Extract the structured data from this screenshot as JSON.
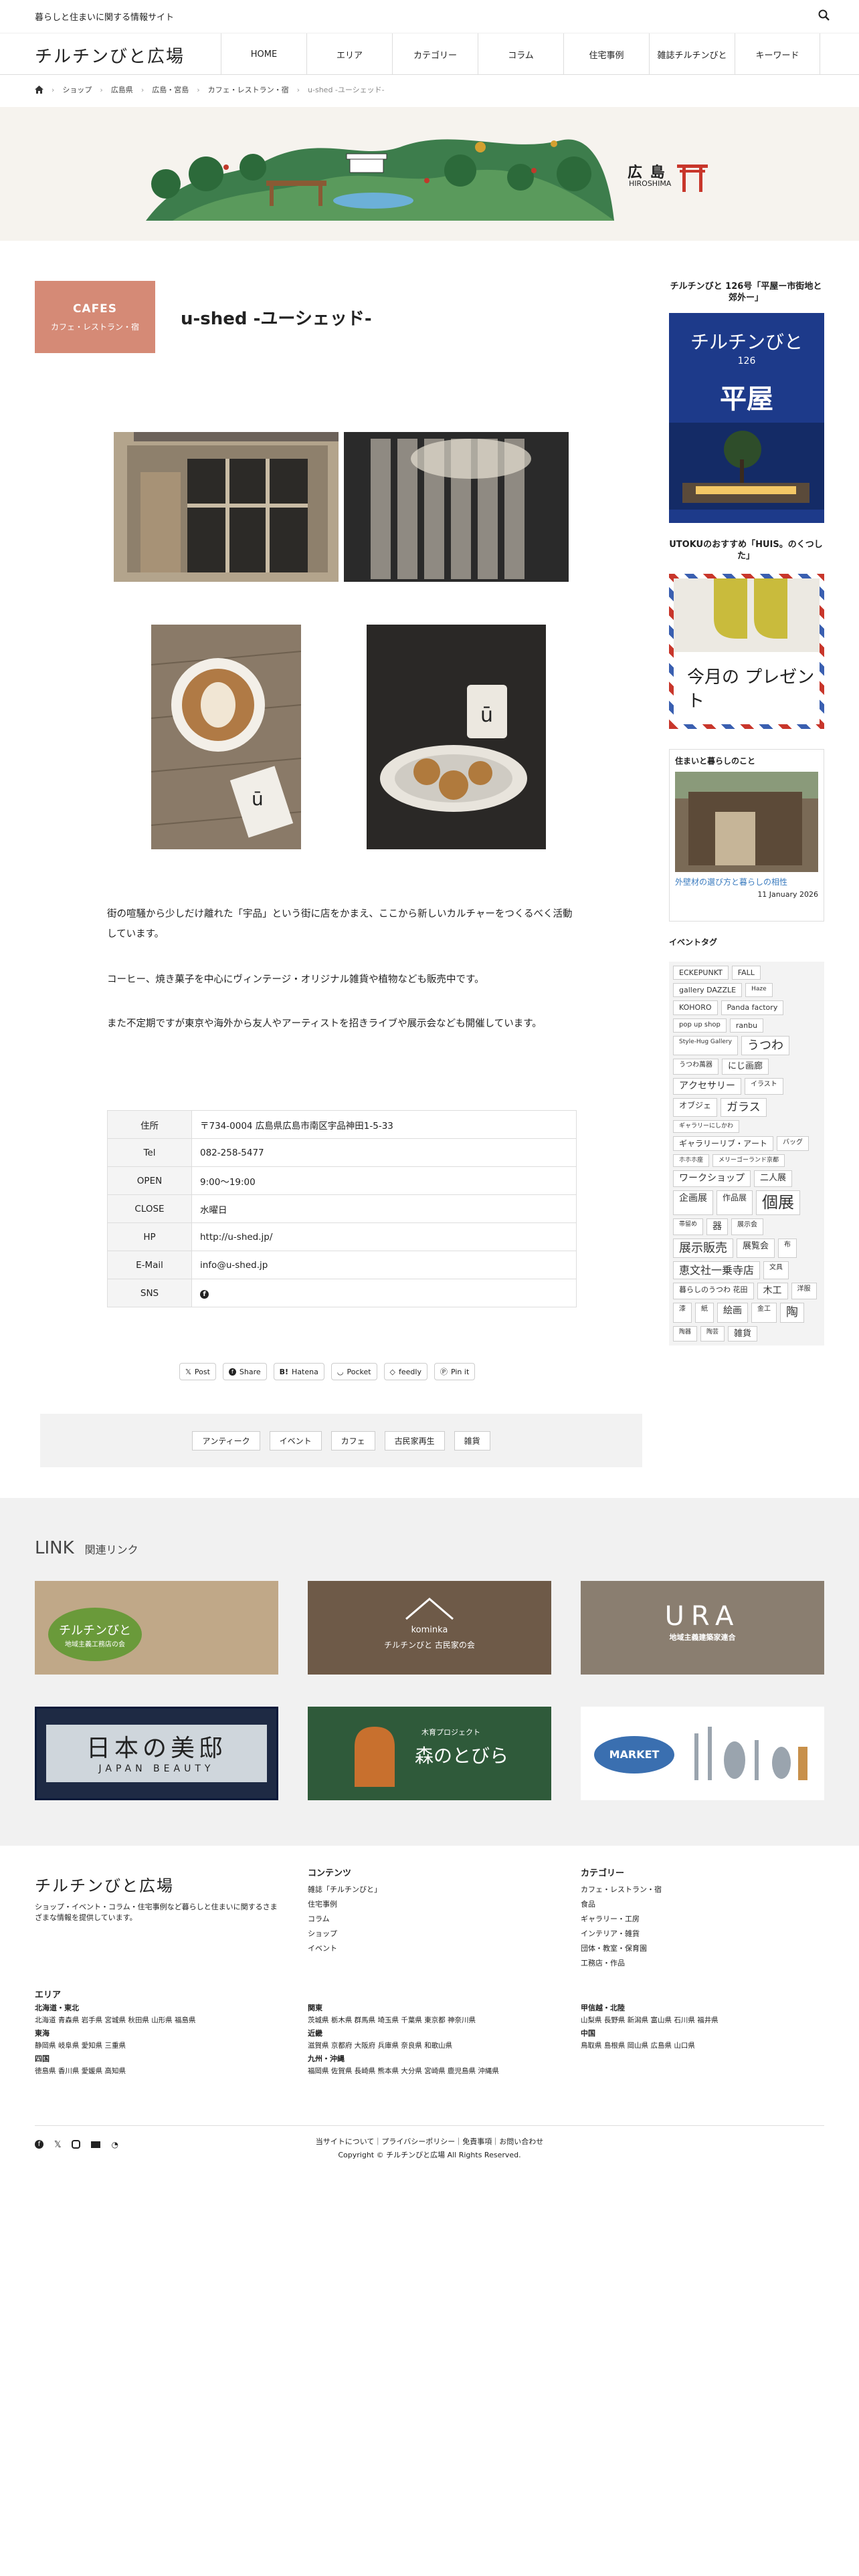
{
  "site": {
    "tagline": "暮らしと住まいに関する情報サイト",
    "logo": "チルチンびと広場"
  },
  "nav": [
    "HOME",
    "エリア",
    "カテゴリー",
    "コラム",
    "住宅事例",
    "雑誌チルチンびと",
    "キーワード"
  ],
  "breadcrumb": [
    "ショップ",
    "広島県",
    "広島・宮島",
    "カフェ・レストラン・宿",
    "u-shed -ユーシェッド-"
  ],
  "banner": {
    "area_jp": "広 島",
    "area_en": "HIROSHIMA"
  },
  "category": {
    "en": "CAFES",
    "jp": "カフェ・レストラン・宿"
  },
  "title": "u-shed -ユーシェッド-",
  "paragraphs": [
    "街の喧騒から少しだけ離れた「宇品」という街に店をかまえ、ここから新しいカルチャーをつくるべく活動しています。",
    "コーヒー、焼き菓子を中心にヴィンテージ・オリジナル雑貨や植物なども販売中です。",
    "また不定期ですが東京や海外から友人やアーティストを招きライブや展示会なども開催しています。"
  ],
  "info": [
    {
      "label": "住所",
      "value": "〒734-0004 広島県広島市南区宇品神田1-5-33"
    },
    {
      "label": "Tel",
      "value": "082-258-5477"
    },
    {
      "label": "OPEN",
      "value": "9:00〜19:00"
    },
    {
      "label": "CLOSE",
      "value": "水曜日"
    },
    {
      "label": "HP",
      "value": "http://u-shed.jp/"
    },
    {
      "label": "E-Mail",
      "value": "info@u-shed.jp"
    },
    {
      "label": "SNS",
      "value": ""
    }
  ],
  "share": [
    "Post",
    "Share",
    "Hatena",
    "Pocket",
    "feedly",
    "Pin it"
  ],
  "tags": [
    "アンティーク",
    "イベント",
    "カフェ",
    "古民家再生",
    "雑貨"
  ],
  "sidebar": {
    "magazine_title": "チルチンびと 126号「平屋ー市街地と郊外ー」",
    "magazine_cover": {
      "logo": "チルチンびと",
      "number": "126",
      "feature": "平屋"
    },
    "present_title": "UTOKUのおすすめ「HUIS。のくつした」",
    "present_text": "今月の プレゼント",
    "article_head": "住まいと暮らしのこと",
    "article_title": "外壁材の選び方と暮らしの相性",
    "article_date": "11 January 2026",
    "event_head": "イベントタグ",
    "event_tags": [
      {
        "t": "ECKEPUNKT",
        "s": 11
      },
      {
        "t": "FALL",
        "s": 11
      },
      {
        "t": "gallery DAZZLE",
        "s": 11
      },
      {
        "t": "Haze",
        "s": 9
      },
      {
        "t": "KOHORO",
        "s": 11
      },
      {
        "t": "Panda factory",
        "s": 11
      },
      {
        "t": "pop up shop",
        "s": 10
      },
      {
        "t": "ranbu",
        "s": 11
      },
      {
        "t": "Style-Hug Gallery",
        "s": 9
      },
      {
        "t": "うつわ",
        "s": 18
      },
      {
        "t": "うつわ萬器",
        "s": 10
      },
      {
        "t": "にじ画廊",
        "s": 13
      },
      {
        "t": "アクセサリー",
        "s": 14
      },
      {
        "t": "イラスト",
        "s": 10
      },
      {
        "t": "オブジェ",
        "s": 12
      },
      {
        "t": "ガラス",
        "s": 17
      },
      {
        "t": "ギャラリーにしかわ",
        "s": 9
      },
      {
        "t": "ギャラリーリブ・アート",
        "s": 12
      },
      {
        "t": "バッグ",
        "s": 10
      },
      {
        "t": "ホホホ座",
        "s": 9
      },
      {
        "t": "メリーゴーランド京都",
        "s": 9
      },
      {
        "t": "ワークショップ",
        "s": 14
      },
      {
        "t": "二人展",
        "s": 13
      },
      {
        "t": "企画展",
        "s": 14
      },
      {
        "t": "作品展",
        "s": 12
      },
      {
        "t": "個展",
        "s": 24
      },
      {
        "t": "帯留め",
        "s": 9
      },
      {
        "t": "器",
        "s": 14
      },
      {
        "t": "展示会",
        "s": 10
      },
      {
        "t": "展示販売",
        "s": 18
      },
      {
        "t": "展覧会",
        "s": 13
      },
      {
        "t": "布",
        "s": 10
      },
      {
        "t": "恵文社一乗寺店",
        "s": 16
      },
      {
        "t": "文具",
        "s": 10
      },
      {
        "t": "暮らしのうつわ 花田",
        "s": 11
      },
      {
        "t": "木工",
        "s": 14
      },
      {
        "t": "洋服",
        "s": 10
      },
      {
        "t": "漆",
        "s": 10
      },
      {
        "t": "紙",
        "s": 10
      },
      {
        "t": "絵画",
        "s": 14
      },
      {
        "t": "金工",
        "s": 10
      },
      {
        "t": "陶",
        "s": 18
      },
      {
        "t": "陶器",
        "s": 9
      },
      {
        "t": "陶芸",
        "s": 9
      },
      {
        "t": "雑貨",
        "s": 13
      }
    ]
  },
  "links": {
    "title": "LINK",
    "subtitle": "関連リンク",
    "items": [
      {
        "name": "チルチンびと",
        "sub": "地域主義工務店の会"
      },
      {
        "name": "kominka",
        "sub": "チルチンびと 古民家の会"
      },
      {
        "name": "URA",
        "sub": "地域主義建築家連合"
      },
      {
        "name": "日本の美邸",
        "sub": "JAPAN BEAUTY"
      },
      {
        "name": "森のとびら",
        "sub": "木育プロジェクト"
      },
      {
        "name": "MARKET",
        "sub": ""
      }
    ]
  },
  "footer": {
    "logo": "チルチンびと広場",
    "desc": "ショップ・イベント・コラム・住宅事例など暮らしと住まいに関するさまざまな情報を提供しています。",
    "contents_head": "コンテンツ",
    "contents": [
      "雑誌「チルチンびと」",
      "住宅事例",
      "コラム",
      "ショップ",
      "イベント"
    ],
    "category_head": "カテゴリー",
    "categories": [
      "カフェ・レストラン・宿",
      "食品",
      "ギャラリー・工房",
      "インテリア・雑貨",
      "団体・教室・保育園",
      "工務店・作品"
    ],
    "area_head": "エリア",
    "areas": [
      {
        "h": "北海道・東北",
        "v": "北海道 青森県 岩手県 宮城県 秋田県 山形県 福島県"
      },
      {
        "h": "関東",
        "v": "茨城県 栃木県 群馬県 埼玉県 千葉県 東京都 神奈川県"
      },
      {
        "h": "甲信越・北陸",
        "v": "山梨県 長野県 新潟県 富山県 石川県 福井県"
      },
      {
        "h": "東海",
        "v": "静岡県 岐阜県 愛知県 三重県"
      },
      {
        "h": "近畿",
        "v": "滋賀県 京都府 大阪府 兵庫県 奈良県 和歌山県"
      },
      {
        "h": "中国",
        "v": "鳥取県 島根県 岡山県 広島県 山口県"
      },
      {
        "h": "四国",
        "v": "徳島県 香川県 愛媛県 高知県"
      },
      {
        "h": "九州・沖縄",
        "v": "福岡県 佐賀県 長崎県 熊本県 大分県 宮崎県 鹿児島県 沖縄県"
      }
    ],
    "bottom_links": "当サイトについて｜プライバシーポリシー｜免責事項｜お問い合わせ",
    "copyright": "Copyright © チルチンびと広場 All Rights Reserved."
  },
  "colors": {
    "accent": "#d58a76",
    "link": "#3a7bbf"
  }
}
